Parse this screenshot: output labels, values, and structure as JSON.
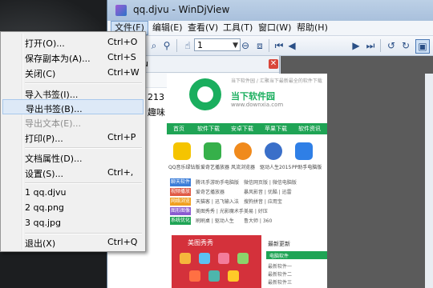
{
  "window": {
    "title": "qq.djvu - WinDjView"
  },
  "menubar": [
    "文件(F)",
    "编辑(E)",
    "查看(V)",
    "工具(T)",
    "窗口(W)",
    "帮助(H)"
  ],
  "toolbar": {
    "page_number": "1"
  },
  "sidepanel": {
    "title": "u",
    "close": "✕",
    "bookmarks": [
      "213",
      "趣味"
    ]
  },
  "file_menu": [
    {
      "label": "打开(O)...",
      "key": "Ctrl+O",
      "enabled": true
    },
    {
      "label": "保存副本为(A)...",
      "key": "Ctrl+S",
      "enabled": true
    },
    {
      "label": "关闭(C)",
      "key": "Ctrl+W",
      "enabled": true
    },
    {
      "label": "导入书签(I)...",
      "key": "",
      "enabled": true
    },
    {
      "label": "导出书签(B)...",
      "key": "",
      "enabled": true,
      "hover": true
    },
    {
      "label": "导出文本(E)...",
      "key": "",
      "enabled": false
    },
    {
      "label": "打印(P)...",
      "key": "Ctrl+P",
      "enabled": true
    },
    {
      "label": "文档属性(D)...",
      "key": "",
      "enabled": true
    },
    {
      "label": "设置(S)...",
      "key": "Ctrl+,",
      "enabled": true
    },
    {
      "label": "1 qq.djvu",
      "key": "",
      "enabled": true
    },
    {
      "label": "2 qq.png",
      "key": "",
      "enabled": true
    },
    {
      "label": "3 qq.jpg",
      "key": "",
      "enabled": true
    },
    {
      "label": "退出(X)",
      "key": "Ctrl+Q",
      "enabled": true
    }
  ],
  "document_page": {
    "site_name": "当下软件园",
    "site_url": "www.downxia.com",
    "slogan": "当下软件园 / 汇聚当下最新最全的软件下载",
    "nav": [
      "首页",
      "软件下载",
      "安卓下载",
      "苹果下载",
      "软件资讯"
    ],
    "apps": [
      "QQ音乐绿钻版",
      "爱奇艺播放器",
      "风流浏览器",
      "驱动人生2015",
      "PP助手电脑版"
    ],
    "rows": [
      {
        "tag": "聊天软件",
        "a": "腾讯手游助手电脑版",
        "b": "微信网页版 | 微信电脑版"
      },
      {
        "tag": "视频播放",
        "a": "爱奇艺播放器",
        "b": "暴风影音 | 优酷 | 迅雷"
      },
      {
        "tag": "网络浏览",
        "a": "天猫客 | 迅飞输入法",
        "b": "搜狗拼音 | 应用宝"
      },
      {
        "tag": "图形图像",
        "a": "美图秀秀 | 光影魔术手",
        "b": "美易 | 好压"
      },
      {
        "tag": "系统优化",
        "a": "刷刷桌 | 驱动人生",
        "b": "鲁大师 | 360"
      }
    ],
    "banner_title": "美图秀秀",
    "latest_title": "最新更新",
    "latest_tab": "电脑软件",
    "latest_items": [
      "最新软件一",
      "最新软件二",
      "最新软件三"
    ]
  }
}
